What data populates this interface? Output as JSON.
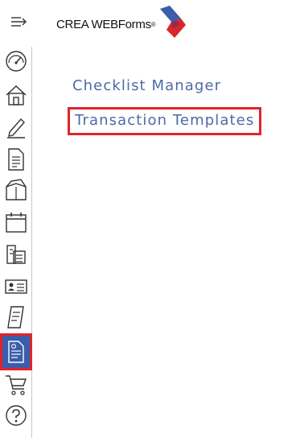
{
  "header": {
    "logo_text": "CREA WEBForms",
    "logo_reg": "®",
    "menu_icon": "menu-collapse-icon"
  },
  "sidebar": {
    "items": [
      {
        "icon": "dashboard-gauge-icon",
        "active": false
      },
      {
        "icon": "home-icon",
        "active": false
      },
      {
        "icon": "pen-icon",
        "active": false
      },
      {
        "icon": "document-icon",
        "active": false
      },
      {
        "icon": "package-box-icon",
        "active": false
      },
      {
        "icon": "calendar-icon",
        "active": false
      },
      {
        "icon": "office-building-icon",
        "active": false
      },
      {
        "icon": "contact-card-icon",
        "active": false
      },
      {
        "icon": "notepad-icon",
        "active": false
      },
      {
        "icon": "forms-template-icon",
        "active": true
      },
      {
        "icon": "shopping-cart-icon",
        "active": false
      },
      {
        "icon": "help-icon",
        "active": false
      }
    ]
  },
  "main": {
    "links": [
      {
        "label": "Checklist Manager"
      },
      {
        "label": "Transaction Templates",
        "highlighted": true
      }
    ]
  },
  "colors": {
    "link": "#4d6aa7",
    "active_bg": "#3a5dac",
    "highlight_border": "#e0242c",
    "logo_blue": "#3a5dac",
    "logo_red": "#d8262d"
  }
}
